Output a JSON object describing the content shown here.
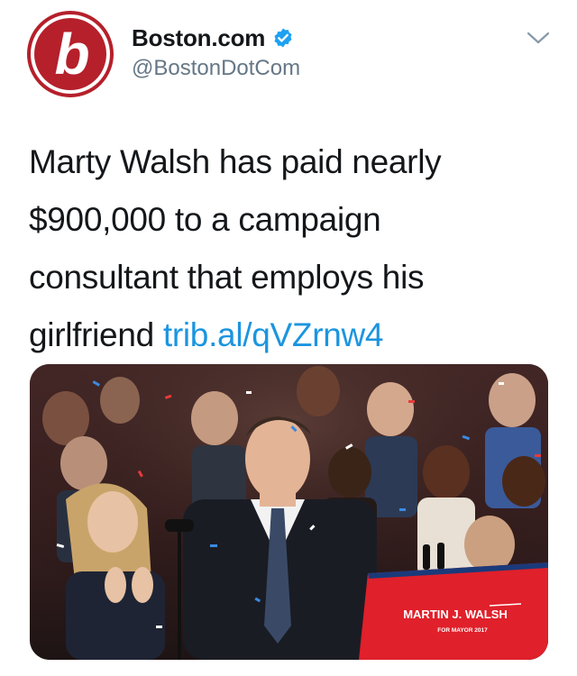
{
  "account": {
    "display_name": "Boston.com",
    "handle": "@BostonDotCom",
    "verified": true,
    "avatar_letter": "b"
  },
  "tweet": {
    "text_before_link": "Marty Walsh has paid nearly $900,000 to a campaign consultant that employs his girlfriend ",
    "link_text": "trib.al/qVZrnw4"
  },
  "media": {
    "sign_title": "MARTIN J. WALSH",
    "sign_subtitle": "FOR MAYOR 2017"
  },
  "colors": {
    "brand_red": "#b5202b",
    "verified_blue": "#1da1f2",
    "link_blue": "#1b95e0",
    "handle_gray": "#657786"
  },
  "icons": {
    "avatar": "boston-com-logo-icon",
    "verified": "verified-badge-icon",
    "menu": "chevron-down-icon"
  }
}
